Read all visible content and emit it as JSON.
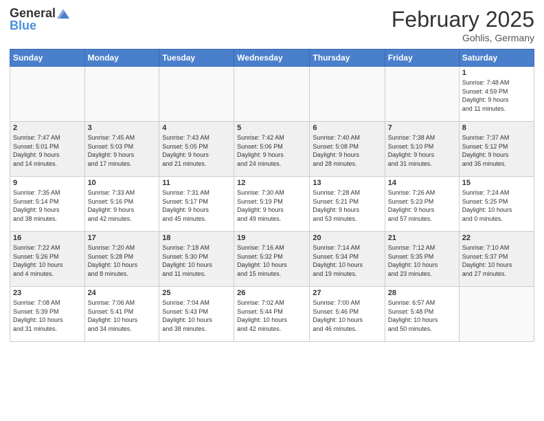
{
  "header": {
    "logo_line1": "General",
    "logo_line2": "Blue",
    "month_title": "February 2025",
    "location": "Gohlis, Germany"
  },
  "weekdays": [
    "Sunday",
    "Monday",
    "Tuesday",
    "Wednesday",
    "Thursday",
    "Friday",
    "Saturday"
  ],
  "weeks": [
    {
      "shaded": false,
      "days": [
        {
          "num": "",
          "info": ""
        },
        {
          "num": "",
          "info": ""
        },
        {
          "num": "",
          "info": ""
        },
        {
          "num": "",
          "info": ""
        },
        {
          "num": "",
          "info": ""
        },
        {
          "num": "",
          "info": ""
        },
        {
          "num": "1",
          "info": "Sunrise: 7:48 AM\nSunset: 4:59 PM\nDaylight: 9 hours\nand 11 minutes."
        }
      ]
    },
    {
      "shaded": true,
      "days": [
        {
          "num": "2",
          "info": "Sunrise: 7:47 AM\nSunset: 5:01 PM\nDaylight: 9 hours\nand 14 minutes."
        },
        {
          "num": "3",
          "info": "Sunrise: 7:45 AM\nSunset: 5:03 PM\nDaylight: 9 hours\nand 17 minutes."
        },
        {
          "num": "4",
          "info": "Sunrise: 7:43 AM\nSunset: 5:05 PM\nDaylight: 9 hours\nand 21 minutes."
        },
        {
          "num": "5",
          "info": "Sunrise: 7:42 AM\nSunset: 5:06 PM\nDaylight: 9 hours\nand 24 minutes."
        },
        {
          "num": "6",
          "info": "Sunrise: 7:40 AM\nSunset: 5:08 PM\nDaylight: 9 hours\nand 28 minutes."
        },
        {
          "num": "7",
          "info": "Sunrise: 7:38 AM\nSunset: 5:10 PM\nDaylight: 9 hours\nand 31 minutes."
        },
        {
          "num": "8",
          "info": "Sunrise: 7:37 AM\nSunset: 5:12 PM\nDaylight: 9 hours\nand 35 minutes."
        }
      ]
    },
    {
      "shaded": false,
      "days": [
        {
          "num": "9",
          "info": "Sunrise: 7:35 AM\nSunset: 5:14 PM\nDaylight: 9 hours\nand 38 minutes."
        },
        {
          "num": "10",
          "info": "Sunrise: 7:33 AM\nSunset: 5:16 PM\nDaylight: 9 hours\nand 42 minutes."
        },
        {
          "num": "11",
          "info": "Sunrise: 7:31 AM\nSunset: 5:17 PM\nDaylight: 9 hours\nand 45 minutes."
        },
        {
          "num": "12",
          "info": "Sunrise: 7:30 AM\nSunset: 5:19 PM\nDaylight: 9 hours\nand 49 minutes."
        },
        {
          "num": "13",
          "info": "Sunrise: 7:28 AM\nSunset: 5:21 PM\nDaylight: 9 hours\nand 53 minutes."
        },
        {
          "num": "14",
          "info": "Sunrise: 7:26 AM\nSunset: 5:23 PM\nDaylight: 9 hours\nand 57 minutes."
        },
        {
          "num": "15",
          "info": "Sunrise: 7:24 AM\nSunset: 5:25 PM\nDaylight: 10 hours\nand 0 minutes."
        }
      ]
    },
    {
      "shaded": true,
      "days": [
        {
          "num": "16",
          "info": "Sunrise: 7:22 AM\nSunset: 5:26 PM\nDaylight: 10 hours\nand 4 minutes."
        },
        {
          "num": "17",
          "info": "Sunrise: 7:20 AM\nSunset: 5:28 PM\nDaylight: 10 hours\nand 8 minutes."
        },
        {
          "num": "18",
          "info": "Sunrise: 7:18 AM\nSunset: 5:30 PM\nDaylight: 10 hours\nand 11 minutes."
        },
        {
          "num": "19",
          "info": "Sunrise: 7:16 AM\nSunset: 5:32 PM\nDaylight: 10 hours\nand 15 minutes."
        },
        {
          "num": "20",
          "info": "Sunrise: 7:14 AM\nSunset: 5:34 PM\nDaylight: 10 hours\nand 19 minutes."
        },
        {
          "num": "21",
          "info": "Sunrise: 7:12 AM\nSunset: 5:35 PM\nDaylight: 10 hours\nand 23 minutes."
        },
        {
          "num": "22",
          "info": "Sunrise: 7:10 AM\nSunset: 5:37 PM\nDaylight: 10 hours\nand 27 minutes."
        }
      ]
    },
    {
      "shaded": false,
      "days": [
        {
          "num": "23",
          "info": "Sunrise: 7:08 AM\nSunset: 5:39 PM\nDaylight: 10 hours\nand 31 minutes."
        },
        {
          "num": "24",
          "info": "Sunrise: 7:06 AM\nSunset: 5:41 PM\nDaylight: 10 hours\nand 34 minutes."
        },
        {
          "num": "25",
          "info": "Sunrise: 7:04 AM\nSunset: 5:43 PM\nDaylight: 10 hours\nand 38 minutes."
        },
        {
          "num": "26",
          "info": "Sunrise: 7:02 AM\nSunset: 5:44 PM\nDaylight: 10 hours\nand 42 minutes."
        },
        {
          "num": "27",
          "info": "Sunrise: 7:00 AM\nSunset: 5:46 PM\nDaylight: 10 hours\nand 46 minutes."
        },
        {
          "num": "28",
          "info": "Sunrise: 6:57 AM\nSunset: 5:48 PM\nDaylight: 10 hours\nand 50 minutes."
        },
        {
          "num": "",
          "info": ""
        }
      ]
    }
  ]
}
